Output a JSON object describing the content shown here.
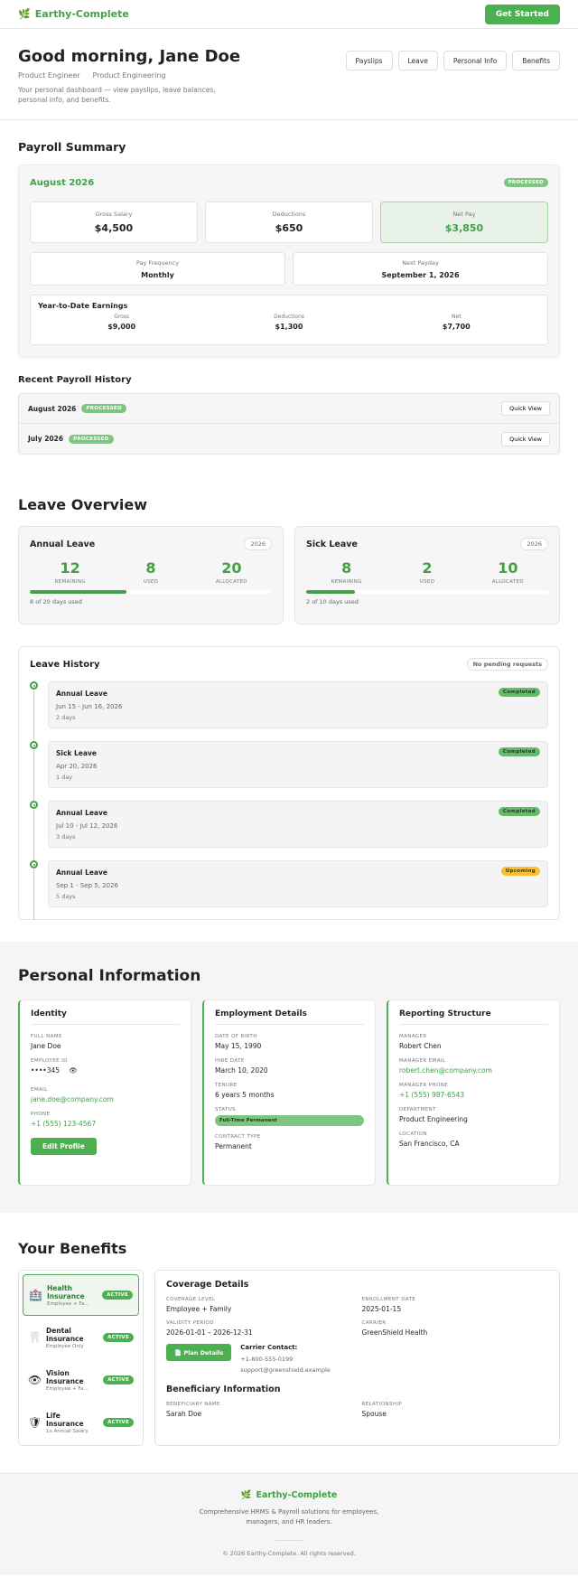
{
  "brand": {
    "name": "Earthy-Complete",
    "icon": "leaf-icon"
  },
  "topbar": {
    "cta": "Get Started"
  },
  "hero": {
    "greeting": "Good morning, Jane Doe",
    "role": "Product Engineer",
    "department": "Product Engineering",
    "description": "Your personal dashboard — view payslips, leave balances, personal info, and benefits.",
    "nav": [
      "Payslips",
      "Leave",
      "Personal Info",
      "Benefits"
    ]
  },
  "payroll": {
    "title": "Payroll Summary",
    "month": "August 2026",
    "status": "PROCESSED",
    "gross_label": "Gross Salary",
    "gross": "$4,500",
    "deductions_label": "Deductions",
    "deductions": "$650",
    "net_label": "Net Pay",
    "net": "$3,850",
    "frequency_label": "Pay Frequency",
    "frequency": "Monthly",
    "payday_label": "Next Payday",
    "payday": "September 1, 2026",
    "ytd": {
      "title": "Year-to-Date Earnings",
      "gross_label": "Gross",
      "gross": "$9,000",
      "deductions_label": "Deductions",
      "deductions": "$1,300",
      "net_label": "Net",
      "net": "$7,700"
    }
  },
  "history": {
    "title": "Recent Payroll History",
    "rows": [
      {
        "month": "August 2026",
        "status": "PROCESSED",
        "action": "Quick View"
      },
      {
        "month": "July 2026",
        "status": "PROCESSED",
        "action": "Quick View"
      }
    ]
  },
  "leave": {
    "title": "Leave Overview",
    "cards": [
      {
        "title": "Annual Leave",
        "year": "2026",
        "remaining": "12",
        "used": "8",
        "allocated": "20",
        "remaining_label": "REMAINING",
        "used_label": "USED",
        "allocated_label": "ALLOCATED",
        "progress": 0.4,
        "footer": "8 of 20 days used"
      },
      {
        "title": "Sick Leave",
        "year": "2026",
        "remaining": "8",
        "used": "2",
        "allocated": "10",
        "remaining_label": "REMAINING",
        "used_label": "USED",
        "allocated_label": "ALLOCATED",
        "progress": 0.2,
        "footer": "2 of 10 days used"
      }
    ],
    "history_title": "Leave History",
    "pending": "No pending requests",
    "history": [
      {
        "type": "Annual Leave",
        "dates": "Jun 15 - Jun 16, 2026",
        "days": "2 days",
        "status": "Completed"
      },
      {
        "type": "Sick Leave",
        "dates": "Apr 20, 2026",
        "days": "1 day",
        "status": "Completed"
      },
      {
        "type": "Annual Leave",
        "dates": "Jul 10 - Jul 12, 2026",
        "days": "3 days",
        "status": "Completed"
      },
      {
        "type": "Annual Leave",
        "dates": "Sep 1 - Sep 5, 2026",
        "days": "5 days",
        "status": "Upcoming"
      }
    ]
  },
  "personal": {
    "title": "Personal Information",
    "identity": {
      "title": "Identity",
      "name_label": "FULL NAME",
      "name": "Jane Doe",
      "id_label": "EMPLOYEE ID",
      "id": "••••345",
      "email_label": "EMAIL",
      "email": "jane.doe@company.com",
      "phone_label": "PHONE",
      "phone": "+1 (555) 123-4567",
      "edit": "Edit Profile"
    },
    "employment": {
      "title": "Employment Details",
      "dob_label": "DATE OF BIRTH",
      "dob": "May 15, 1990",
      "hire_label": "HIRE DATE",
      "hire": "March 10, 2020",
      "tenure_label": "TENURE",
      "tenure": "6 years 5 months",
      "status_label": "STATUS",
      "status": "Full-Time Permanent",
      "contract_label": "CONTRACT TYPE",
      "contract": "Permanent"
    },
    "reporting": {
      "title": "Reporting Structure",
      "manager_label": "MANAGER",
      "manager": "Robert Chen",
      "memail_label": "MANAGER EMAIL",
      "memail": "robert.chen@company.com",
      "mphone_label": "MANAGER PHONE",
      "mphone": "+1 (555) 987-6543",
      "dept_label": "DEPARTMENT",
      "dept": "Product Engineering",
      "loc_label": "LOCATION",
      "loc": "San Francisco, CA"
    }
  },
  "benefits": {
    "title": "Your Benefits",
    "items": [
      {
        "name": "Health Insurance",
        "sub": "Employee + Fa...",
        "status": "ACTIVE",
        "icon": "hospital-icon"
      },
      {
        "name": "Dental Insurance",
        "sub": "Employee Only",
        "status": "ACTIVE",
        "icon": "tooth-icon"
      },
      {
        "name": "Vision Insurance",
        "sub": "Employee + Fa...",
        "status": "ACTIVE",
        "icon": "eye-icon"
      },
      {
        "name": "Life Insurance",
        "sub": "1x Annual Salary",
        "status": "ACTIVE",
        "icon": "shield-icon"
      }
    ],
    "coverage": {
      "title": "Coverage Details",
      "level_label": "COVERAGE LEVEL",
      "level": "Employee + Family",
      "enroll_label": "ENROLLMENT DATE",
      "enroll": "2025-01-15",
      "validity_label": "VALIDITY PERIOD",
      "validity": "2026-01-01 – 2026-12-31",
      "carrier_label": "CARRIER",
      "carrier": "GreenShield Health",
      "plan_button": "Plan Details",
      "contact_title": "Carrier Contact:",
      "contact_phone": "+1-800-555-0199",
      "contact_email": "support@greenshield.example"
    },
    "beneficiary": {
      "title": "Beneficiary Information",
      "name_label": "BENEFICIARY NAME",
      "name": "Sarah Doe",
      "rel_label": "RELATIONSHIP",
      "rel": "Spouse"
    }
  },
  "footer": {
    "tagline": "Comprehensive HRMS & Payroll solutions for employees, managers, and HR leaders.",
    "copyright": "© 2026 Earthy-Complete. All rights reserved."
  }
}
